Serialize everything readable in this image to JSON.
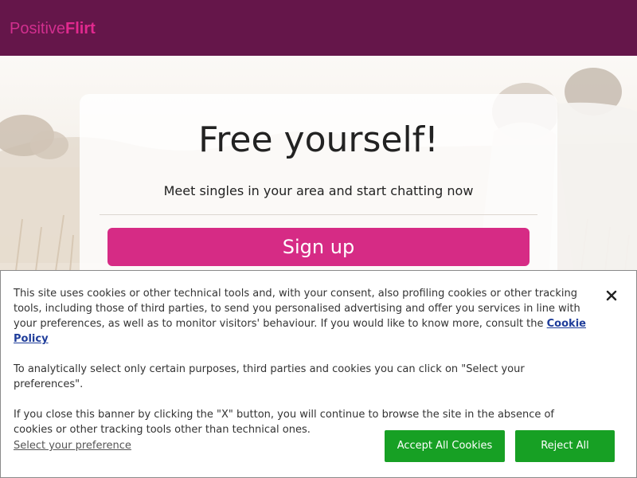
{
  "header": {
    "logo_part1": "Positive",
    "logo_part2": "Flirt"
  },
  "hero": {
    "title": "Free yourself!",
    "subtitle": "Meet singles in your area and start chatting now",
    "signup_label": "Sign up"
  },
  "cookie_banner": {
    "paragraph1": "This site uses cookies or other technical tools and, with your consent, also profiling cookies or other tracking tools, including those of third parties, to send you personalised advertising and offer you services in line with your preferences, as well as to monitor visitors' behaviour. If you would like to know more, consult the ",
    "policy_link": "Cookie Policy",
    "paragraph2": "To analytically select only certain purposes, third parties and cookies you can click on \"Select your preferences\".",
    "paragraph3": "If you close this banner by clicking the \"X\" button, you will continue to browse the site in the absence of cookies or other tracking tools other than technical ones.",
    "preference_link": "Select your preference",
    "accept_label": "Accept All Cookies",
    "reject_label": "Reject All",
    "close_icon": "close-icon"
  },
  "colors": {
    "header_bg": "#65164a",
    "brand_pink": "#d62b85",
    "cookie_button_green": "#17a024",
    "link_blue": "#1f3d9a"
  }
}
